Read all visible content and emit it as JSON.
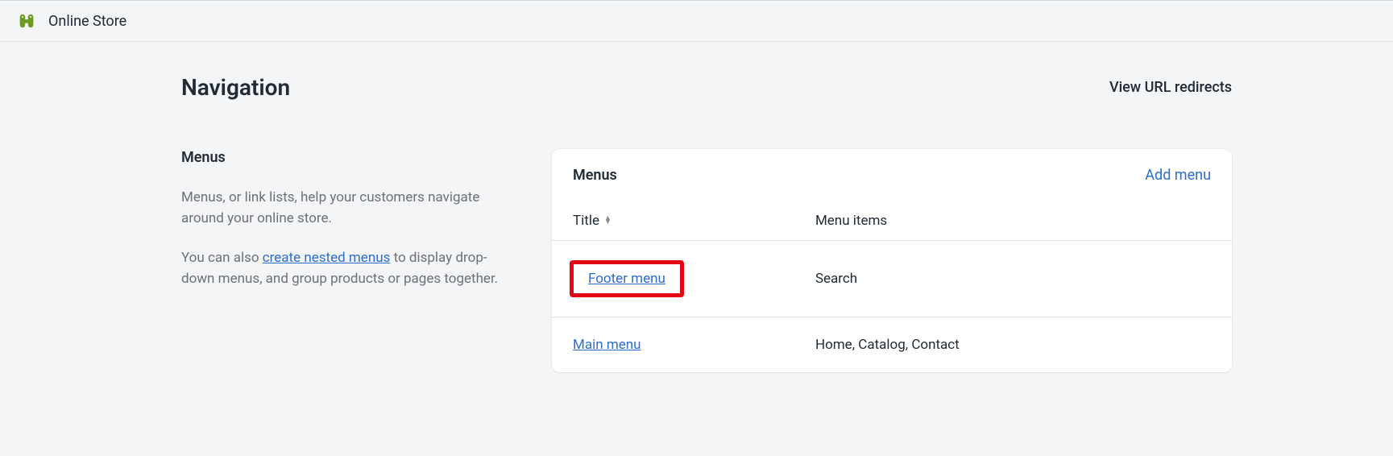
{
  "header": {
    "title": "Online Store"
  },
  "page": {
    "title": "Navigation",
    "redirects_link": "View URL redirects"
  },
  "sidebar": {
    "heading": "Menus",
    "para1": "Menus, or link lists, help your customers navigate around your online store.",
    "para2_pre": "You can also ",
    "para2_link": "create nested menus",
    "para2_post": " to display drop-down menus, and group products or pages together."
  },
  "card": {
    "heading": "Menus",
    "add_menu": "Add menu",
    "col_title": "Title",
    "col_items": "Menu items",
    "rows": [
      {
        "title": "Footer menu",
        "items": "Search"
      },
      {
        "title": "Main menu",
        "items": "Home, Catalog, Contact"
      }
    ]
  }
}
